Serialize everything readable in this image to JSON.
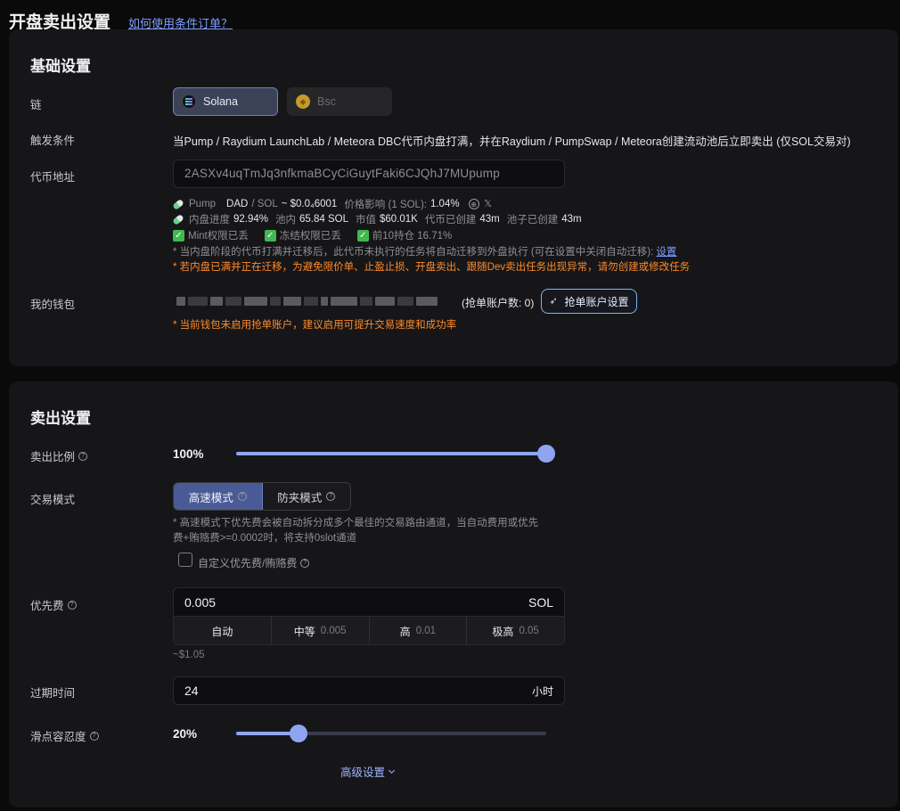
{
  "header": {
    "title": "开盘卖出设置",
    "help_link": "如何使用条件订单？"
  },
  "basic": {
    "title": "基础设置",
    "chain_label": "链",
    "chains": [
      "Solana",
      "Bsc"
    ],
    "selected_chain": "Solana",
    "trigger_label": "触发条件",
    "trigger_text": "当Pump / Raydium LaunchLab / Meteora DBC代币内盘打满，并在Raydium / PumpSwap / Meteora创建流动池后立即卖出 (仅SOL交易对)",
    "token_label": "代币地址",
    "token_address": "2ASXv4uqTmJq3nfkmaBCyCiGuytFaki6CJQhJ7MUpump",
    "info": {
      "platform": "Pump",
      "pair": "DAD",
      "quote": "/ SOL",
      "price": "~ $0.0₄6001",
      "impact_label": "价格影响 (1 SOL):",
      "impact_value": "1.04%",
      "progress_label": "内盘进度",
      "progress_value": "92.94%",
      "pool_label": "池内",
      "pool_value": "65.84 SOL",
      "mcap_label": "市值",
      "mcap_value": "$60.01K",
      "token_created_label": "代币已创建",
      "token_created_value": "43m",
      "pool_created_label": "池子已创建",
      "pool_created_value": "43m",
      "checks": [
        "Mint权限已丢",
        "冻结权限已丢",
        "前10持仓 16.71%"
      ]
    },
    "migrate_note": "* 当内盘阶段的代币打满并迁移后，此代币未执行的任务将自动迁移到外盘执行 (可在设置中关闭自动迁移):",
    "migrate_link": "设置",
    "migrate_warning": "* 若内盘已满并正在迁移，为避免限价单、止盈止损、开盘卖出、跟随Dev卖出任务出现异常，请勿创建或修改任务",
    "wallet_label": "我的钱包",
    "grab_count": "(抢单账户数: 0)",
    "grab_button": "抢单账户设置",
    "wallet_warning": "* 当前钱包未启用抢单账户，建议启用可提升交易速度和成功率"
  },
  "sell": {
    "title": "卖出设置",
    "ratio_label": "卖出比例",
    "ratio_value": "100%",
    "ratio_pct": 100,
    "mode_label": "交易模式",
    "modes": [
      "高速模式",
      "防夹模式"
    ],
    "selected_mode": "高速模式",
    "mode_note_1": "* 高速模式下优先费会被自动拆分成多个最佳的交易路由通道，当自动费用或优先",
    "mode_note_2": "费+贿赂费>=0.0002时，将支持0slot通道",
    "custom_fee_label": "自定义优先费/贿赂费",
    "custom_fee_checked": false,
    "priority_label": "优先费",
    "priority_value": "0.005",
    "priority_unit": "SOL",
    "fee_options": [
      {
        "label": "自动",
        "value": ""
      },
      {
        "label": "中等",
        "value": "0.005"
      },
      {
        "label": "高",
        "value": "0.01"
      },
      {
        "label": "极高",
        "value": "0.05"
      }
    ],
    "priority_usd": "~$1.05",
    "expire_label": "过期时间",
    "expire_value": "24",
    "expire_unit": "小时",
    "slippage_label": "滑点容忍度",
    "slippage_value": "20%",
    "slippage_pct": 20,
    "advanced_label": "高级设置"
  },
  "colors": {
    "accent": "#8fa5f2",
    "warning": "#ff8a2a",
    "link": "#7e9cff",
    "check": "#3fb950"
  }
}
